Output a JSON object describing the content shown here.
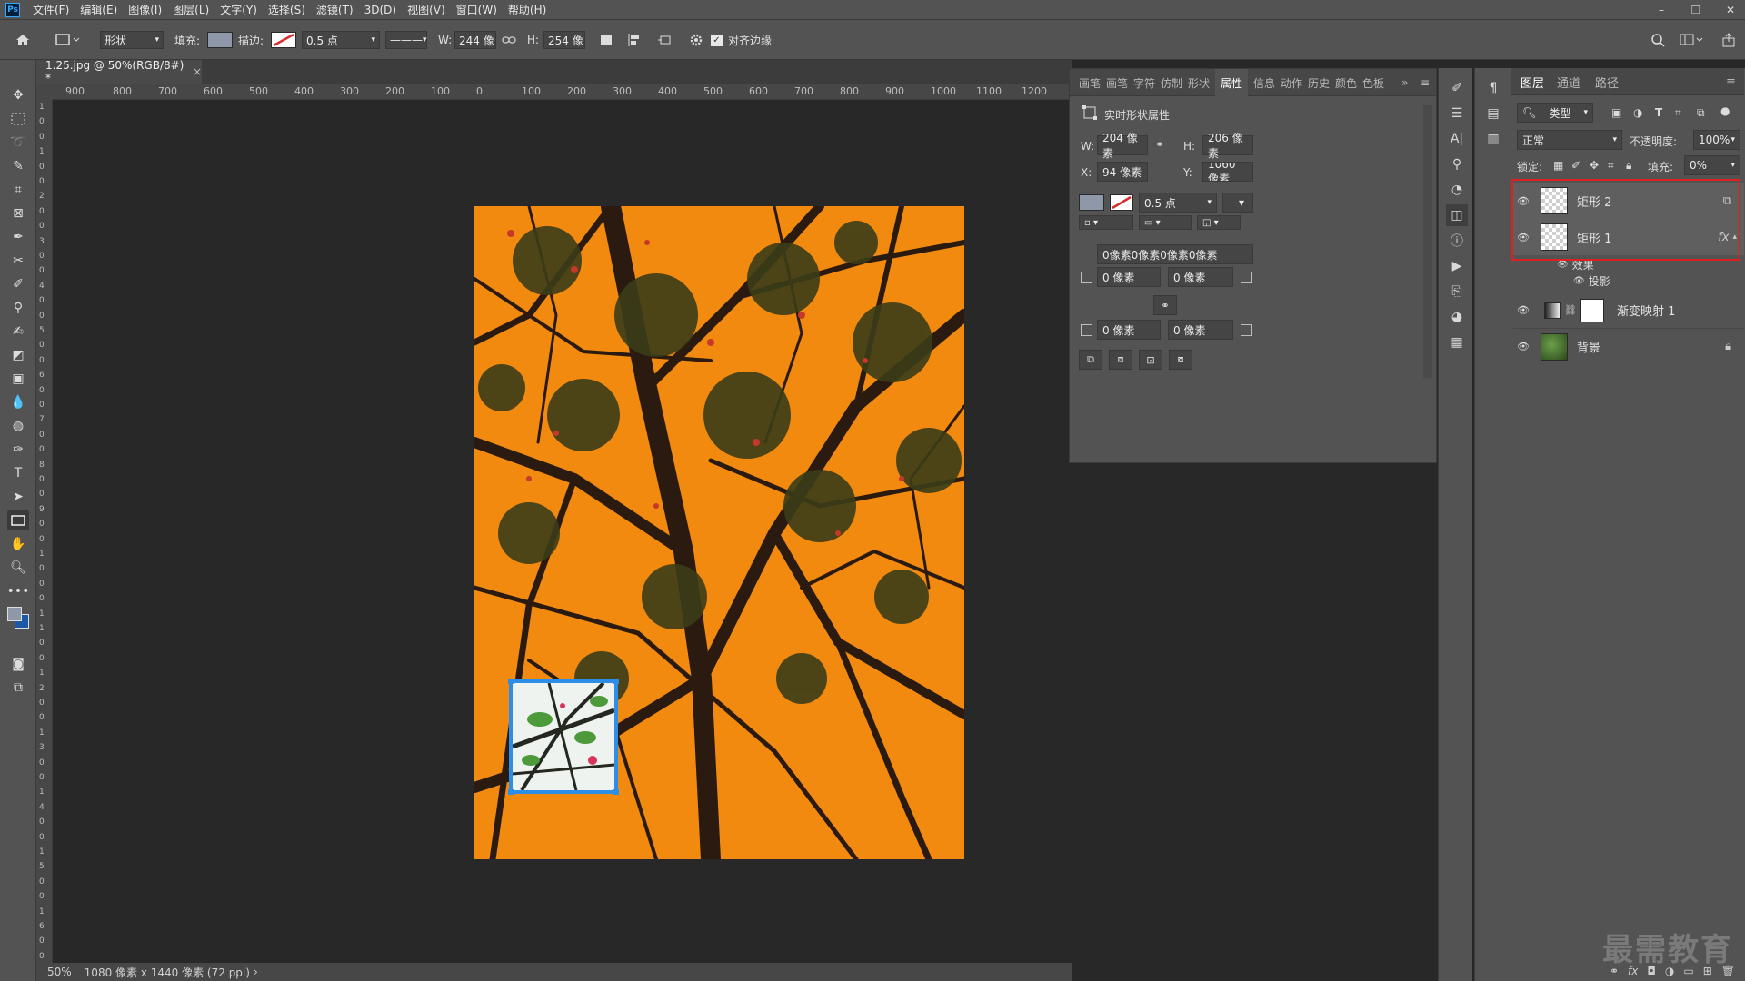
{
  "menubar": {
    "logo": "Ps",
    "items": [
      "文件(F)",
      "编辑(E)",
      "图像(I)",
      "图层(L)",
      "文字(Y)",
      "选择(S)",
      "滤镜(T)",
      "3D(D)",
      "视图(V)",
      "窗口(W)",
      "帮助(H)"
    ],
    "window_controls": [
      "–",
      "❐",
      "✕"
    ]
  },
  "options": {
    "mode": "形状",
    "fill_label": "填充:",
    "stroke_label": "描边:",
    "stroke_width": "0.5 点",
    "w_label": "W:",
    "w_value": "244 像",
    "h_label": "H:",
    "h_value": "254 像",
    "align_edges": "对齐边缘",
    "fill_color": "#8e98a8",
    "stroke_color": "#d43030"
  },
  "document": {
    "tab_title": "1.25.jpg @ 50%(RGB/8#) *",
    "tab_close": "×",
    "ruler_top": [
      "900",
      "800",
      "700",
      "600",
      "500",
      "400",
      "300",
      "200",
      "100",
      "0",
      "100",
      "200",
      "300",
      "400",
      "500",
      "600",
      "700",
      "800",
      "900",
      "1000",
      "1100",
      "1200"
    ],
    "ruler_left": [
      "1",
      "0",
      "0",
      "1",
      "0",
      "0",
      "2",
      "0",
      "0",
      "3",
      "0",
      "0",
      "4",
      "0",
      "0",
      "5",
      "0",
      "0",
      "6",
      "0",
      "0",
      "7",
      "0",
      "0",
      "8",
      "0",
      "0",
      "9",
      "0",
      "0",
      "1",
      "0",
      "0",
      "0",
      "1",
      "1",
      "0",
      "0",
      "1",
      "2",
      "0",
      "0",
      "1",
      "3",
      "0",
      "0",
      "1",
      "4",
      "0",
      "0",
      "1",
      "5",
      "0",
      "0",
      "1",
      "6",
      "0",
      "0"
    ],
    "status_zoom": "50%",
    "status_info": "1080 像素 x 1440 像素 (72 ppi)",
    "status_arrow": "›"
  },
  "properties": {
    "tabs": [
      "画笔",
      "画笔",
      "字符",
      "仿制",
      "形状",
      "属性",
      "信息",
      "动作",
      "历史",
      "颜色",
      "色板"
    ],
    "active_tab": "属性",
    "section_title": "实时形状属性",
    "w_label": "W:",
    "w_value": "204 像素",
    "h_label": "H:",
    "h_value": "206 像素",
    "x_label": "X:",
    "x_value": "94 像素",
    "y_label": "Y:",
    "y_value": "1060 像素",
    "stroke_width": "0.5 点",
    "corner_summary": "0像素0像素0像素0像素",
    "corner_tl": "0 像素",
    "corner_tr": "0 像素",
    "corner_bl": "0 像素",
    "corner_br": "0 像素"
  },
  "layers": {
    "tabs": [
      "图层",
      "通道",
      "路径"
    ],
    "filter_kind": "类型",
    "blend_mode": "正常",
    "opacity_label": "不透明度:",
    "opacity_value": "100%",
    "lock_label": "锁定:",
    "fill_label": "填充:",
    "fill_value": "0%",
    "rows": [
      {
        "name": "矩形 2"
      },
      {
        "name": "矩形 1",
        "fx": "fx"
      },
      {
        "name": "渐变映射 1"
      },
      {
        "name": "背景"
      }
    ],
    "effects_label": "效果",
    "drop_shadow_label": "投影"
  },
  "watermark": "最需教育"
}
